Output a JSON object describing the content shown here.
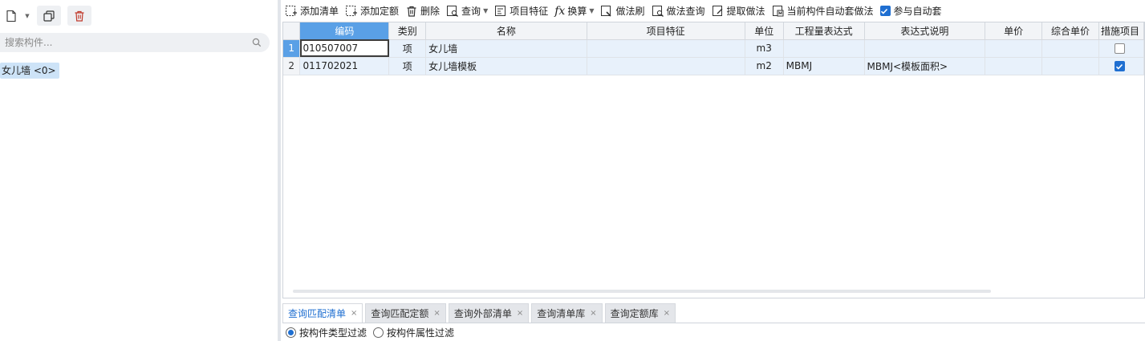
{
  "left": {
    "search_placeholder": "搜索构件...",
    "component_item": "女儿墙 <0>"
  },
  "toolbar": {
    "add_list": "添加清单",
    "add_quota": "添加定额",
    "delete": "删除",
    "query": "查询",
    "item_feature": "项目特征",
    "convert": "换算",
    "method_brush": "做法刷",
    "method_query": "做法查询",
    "extract_method": "提取做法",
    "auto_apply": "当前构件自动套做法",
    "participate_auto": "参与自动套"
  },
  "grid": {
    "headers": [
      "编码",
      "类别",
      "名称",
      "项目特征",
      "单位",
      "工程量表达式",
      "表达式说明",
      "单价",
      "综合单价",
      "措施项目"
    ],
    "rows": [
      {
        "num": "1",
        "code": "010507007",
        "type": "项",
        "name": "女儿墙",
        "feature": "",
        "unit": "m3",
        "expr": "",
        "expr_desc": "",
        "price": "",
        "comp_price": "",
        "measure": false
      },
      {
        "num": "2",
        "code": "011702021",
        "type": "项",
        "name": "女儿墙模板",
        "feature": "",
        "unit": "m2",
        "expr": "MBMJ",
        "expr_desc": "MBMJ<模板面积>",
        "price": "",
        "comp_price": "",
        "measure": true
      }
    ]
  },
  "tabs": [
    {
      "label": "查询匹配清单",
      "active": true
    },
    {
      "label": "查询匹配定额",
      "active": false
    },
    {
      "label": "查询外部清单",
      "active": false
    },
    {
      "label": "查询清单库",
      "active": false
    },
    {
      "label": "查询定额库",
      "active": false
    }
  ],
  "filters": {
    "by_type": "按构件类型过滤",
    "by_attr": "按构件属性过滤"
  },
  "colors": {
    "accent": "#1f6fd1",
    "header_active": "#5aa0e6",
    "row_bg": "#e8f1fb"
  }
}
